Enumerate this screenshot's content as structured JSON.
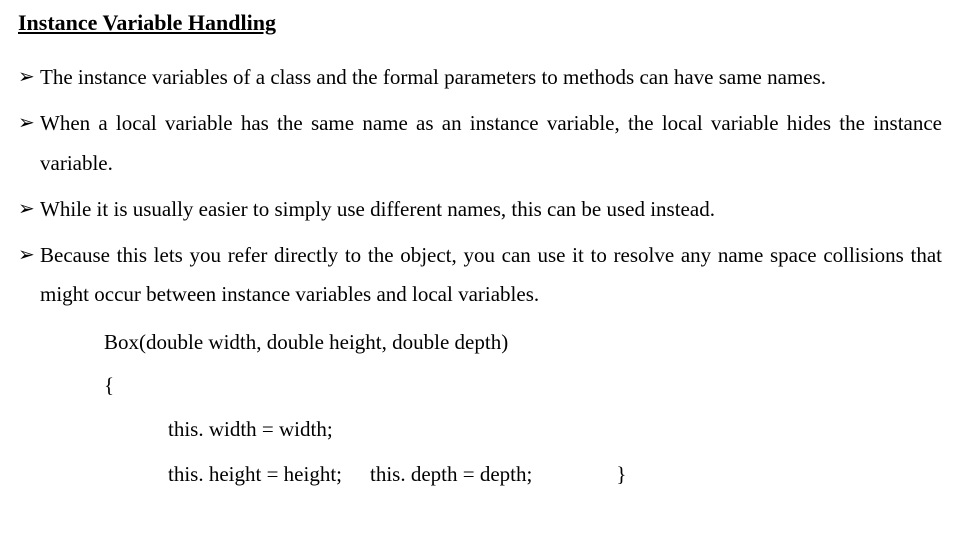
{
  "heading": "Instance Variable Handling",
  "bullet_marker": "➢",
  "bullets": {
    "b0": "The instance variables of a class and the formal parameters to methods can have same names.",
    "b1": "When a local variable has the same name as an instance variable, the local variable hides the instance variable.",
    "b2": "While it is usually easier to simply use different names, this can be used instead.",
    "b3": "Because this lets you refer directly to the object, you can use it to resolve any name space collisions that might occur between instance variables and local variables."
  },
  "code": {
    "sig": "Box(double width, double height, double depth)",
    "open": "{",
    "l1": "this. width = width;",
    "l2a": "this. height = height;",
    "l2b": "this. depth = depth;",
    "close": "}"
  }
}
